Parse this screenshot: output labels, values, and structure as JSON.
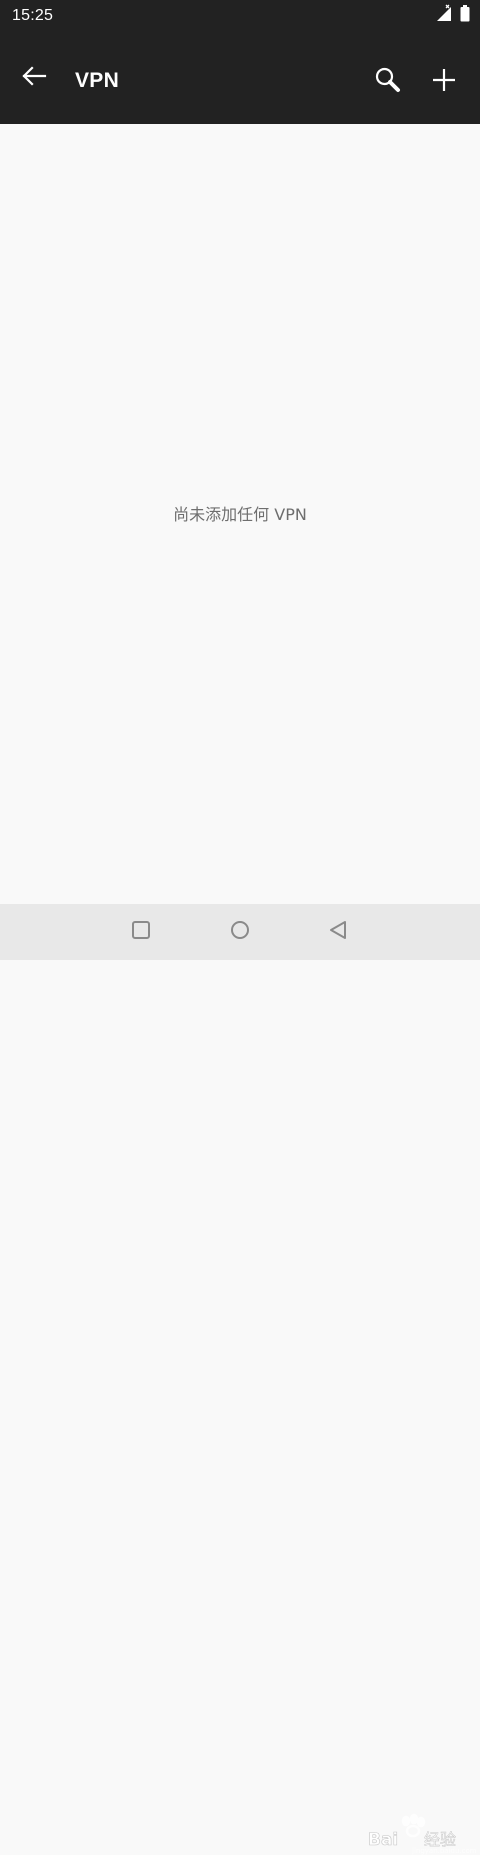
{
  "status_bar": {
    "time": "15:25",
    "icons": [
      "signal-icon",
      "battery-icon"
    ]
  },
  "app_bar": {
    "title": "VPN",
    "icons": [
      "back-arrow-icon",
      "search-icon",
      "plus-icon"
    ]
  },
  "content": {
    "empty_message": "尚未添加任何 VPN"
  },
  "nav_bar": {
    "icons": [
      "recents-square-icon",
      "home-circle-icon",
      "back-triangle-icon"
    ]
  },
  "colors": {
    "toolbar_background": "#222222",
    "page_background": "#f9f9f9",
    "nav_background": "#e8e8e8",
    "empty_text": "#6e6e6e"
  },
  "watermark": {
    "text": "Baidu经验"
  }
}
